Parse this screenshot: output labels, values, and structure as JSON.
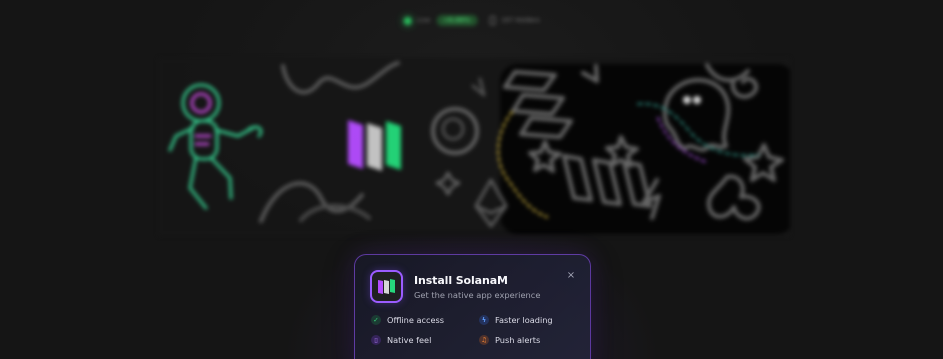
{
  "top_bar": {
    "live_label": "Live",
    "percent": "+0.00%",
    "holders": "167 Holders"
  },
  "install_prompt": {
    "title": "Install SolanaM",
    "subtitle": "Get the native app experience",
    "close_symbol": "×",
    "features": [
      {
        "label": "Offline access",
        "icon": "check-icon",
        "color": "#38d67d"
      },
      {
        "label": "Faster loading",
        "icon": "lightning-icon",
        "color": "#5f9eff"
      },
      {
        "label": "Native feel",
        "icon": "phone-icon",
        "color": "#b17cff"
      },
      {
        "label": "Push alerts",
        "icon": "bell-icon",
        "color": "#ff8b36"
      }
    ]
  },
  "colors": {
    "brand_purple": "#9b5cff",
    "brand_green": "#26d77c",
    "background": "#151515"
  }
}
